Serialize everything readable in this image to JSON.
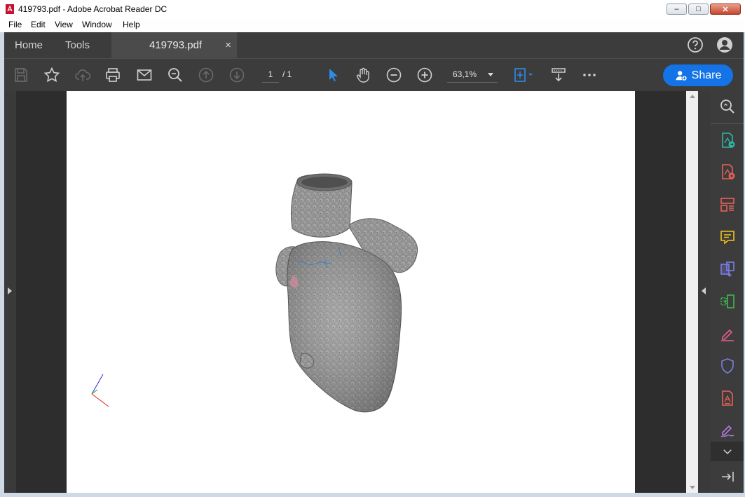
{
  "window": {
    "title": "419793.pdf - Adobe Acrobat Reader DC",
    "minimize": "–",
    "maximize": "□",
    "close": "✕"
  },
  "menu": {
    "file": "File",
    "edit": "Edit",
    "view": "View",
    "window": "Window",
    "help": "Help"
  },
  "tabs": {
    "home": "Home",
    "tools": "Tools",
    "document": "419793.pdf",
    "close": "×"
  },
  "toolbar": {
    "page_current": "1",
    "page_total": "/ 1",
    "zoom": "63,1%",
    "share_label": "Share"
  },
  "colors": {
    "accent": "#1473e6",
    "toolbar_bg": "#3c3c3c",
    "doc_bg": "#2d2d2d",
    "model_gray": "#8c8c8c"
  },
  "document": {
    "content": "3D heart model render",
    "axes": [
      "x",
      "y",
      "z"
    ]
  }
}
